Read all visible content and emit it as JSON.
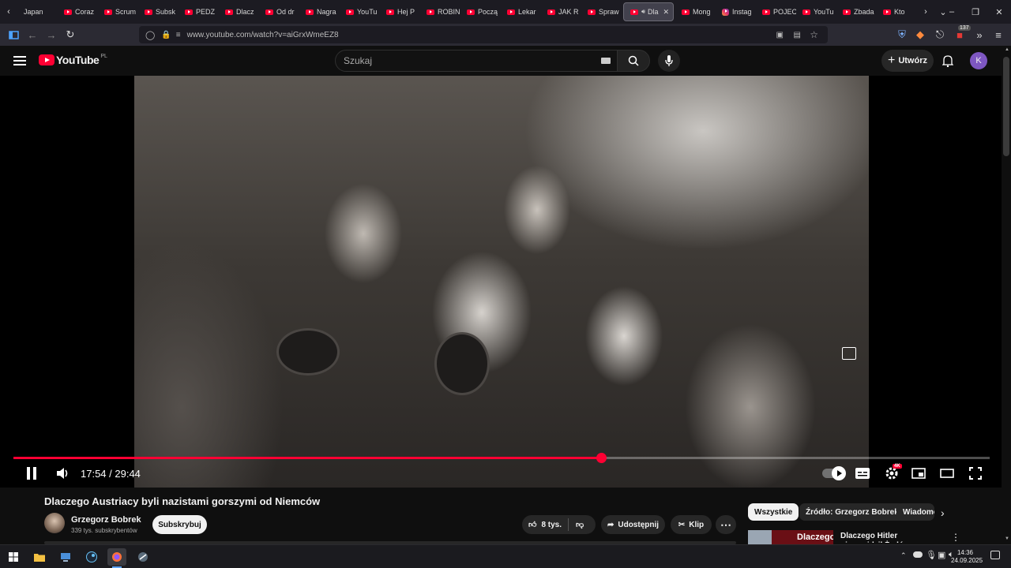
{
  "browser": {
    "tabs": [
      {
        "label": "Japan",
        "type": "plain"
      },
      {
        "label": "Coraz",
        "type": "yt"
      },
      {
        "label": "Scrum",
        "type": "yt"
      },
      {
        "label": "Subsk",
        "type": "yt"
      },
      {
        "label": "PEDZ",
        "type": "yt"
      },
      {
        "label": "Dlacz",
        "type": "yt"
      },
      {
        "label": "Od dr",
        "type": "yt"
      },
      {
        "label": "Nagra",
        "type": "yt"
      },
      {
        "label": "YouTu",
        "type": "yt"
      },
      {
        "label": "Hej P",
        "type": "yt"
      },
      {
        "label": "ROBIN",
        "type": "yt"
      },
      {
        "label": "Począ",
        "type": "yt"
      },
      {
        "label": "Lekar",
        "type": "yt"
      },
      {
        "label": "JAK R",
        "type": "yt"
      },
      {
        "label": "Spraw",
        "type": "yt"
      },
      {
        "label": "Dla",
        "type": "yt",
        "active": true
      },
      {
        "label": "Mong",
        "type": "yt"
      },
      {
        "label": "Instag",
        "type": "insta"
      },
      {
        "label": "POJEC",
        "type": "yt"
      },
      {
        "label": "YouTu",
        "type": "yt"
      },
      {
        "label": "Zbada",
        "type": "yt"
      },
      {
        "label": "Kto",
        "type": "yt"
      }
    ],
    "url": "www.youtube.com/watch?v=aiGrxWmeEZ8",
    "extension_badge": "137"
  },
  "youtube": {
    "logo_text": "YouTube",
    "region": "PL",
    "search_placeholder": "Szukaj",
    "create_label": "Utwórz",
    "avatar_letter": "K"
  },
  "player": {
    "current_time": "17:54",
    "duration": "29:44",
    "time_display": "17:54 / 29:44",
    "progress_fraction": 0.6016,
    "quality_badge": "4K"
  },
  "video": {
    "title": "Dlaczego Austriacy byli nazistami gorszymi od Niemców",
    "channel_name": "Grzegorz Bobrek",
    "subscribers": "339 tys. subskrybentów",
    "subscribe_label": "Subskrybuj",
    "likes": "8 tys.",
    "share_label": "Udostępnij",
    "clip_label": "Klip"
  },
  "chips": [
    "Wszystkie",
    "Źródło: Grzegorz Bobrek",
    "Wiadomo"
  ],
  "recommendation": {
    "thumb_text": "Dlaczego Hitler",
    "title": "Dlaczego Hitler nienawidził Żydów - kulisy obsesji"
  },
  "taskbar": {
    "time": "14:36",
    "date": "24.09.2025"
  },
  "colors": {
    "accent": "#ff0033",
    "background": "#0f0f0f"
  }
}
